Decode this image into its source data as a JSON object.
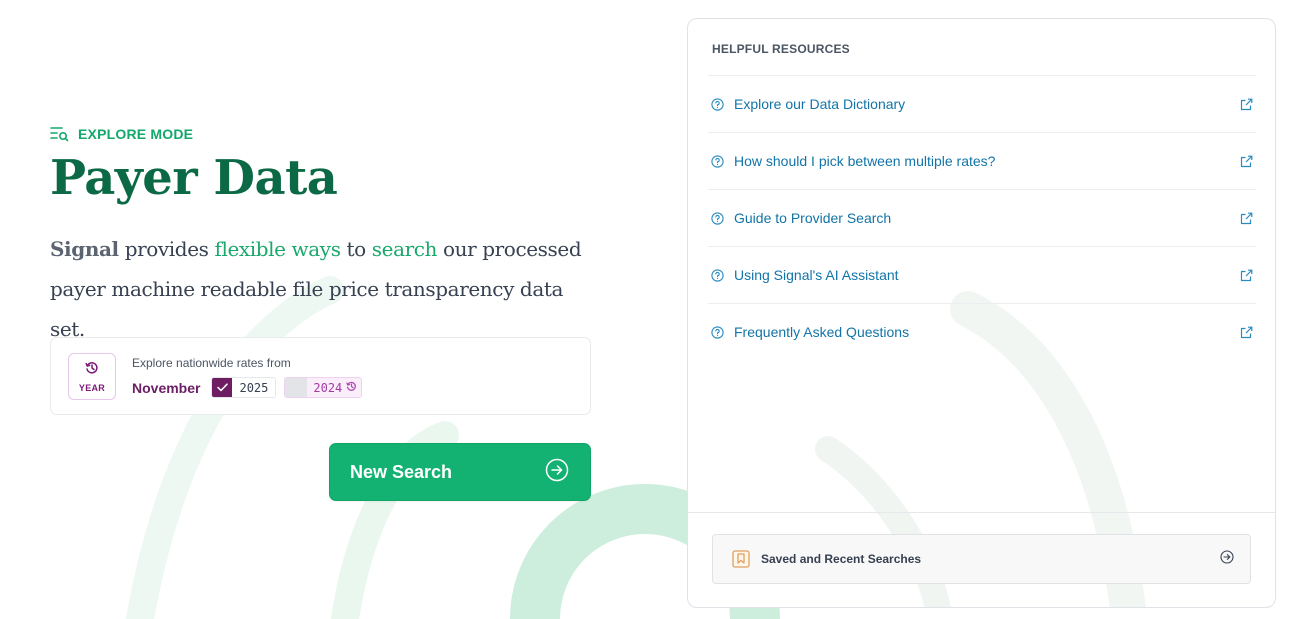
{
  "hero": {
    "mode_label": "EXPLORE MODE",
    "title": "Payer Data",
    "desc_brand": "Signal",
    "desc_p1": " provides ",
    "desc_hl1": "flexible ways",
    "desc_p2": " to ",
    "desc_hl2": "search",
    "desc_p3": " our processed payer machine readable file price transparency data set."
  },
  "year_card": {
    "badge_label": "YEAR",
    "prompt": "Explore nationwide rates from",
    "month": "November",
    "years": [
      {
        "label": "2025",
        "selected": true
      },
      {
        "label": "2024",
        "selected": false
      }
    ]
  },
  "new_search": {
    "label": "New Search"
  },
  "resources": {
    "title": "HELPFUL RESOURCES",
    "items": [
      {
        "label": "Explore our Data Dictionary"
      },
      {
        "label": "How should I pick between multiple rates?"
      },
      {
        "label": "Guide to Provider Search"
      },
      {
        "label": "Using Signal's AI Assistant"
      },
      {
        "label": "Frequently Asked Questions"
      }
    ]
  },
  "saved": {
    "label": "Saved and Recent Searches"
  },
  "icons": {
    "mode": "explore-search-icon",
    "year": "history-icon",
    "check": "check-icon",
    "question": "question-circle-icon",
    "external": "external-link-icon",
    "arrow": "arrow-right-circle-icon",
    "bookmark": "bookmark-icon"
  },
  "colors": {
    "brand_green": "#13b272",
    "title_green": "#0b6a45",
    "link_blue": "#1274a8",
    "plum": "#6e1d62"
  }
}
